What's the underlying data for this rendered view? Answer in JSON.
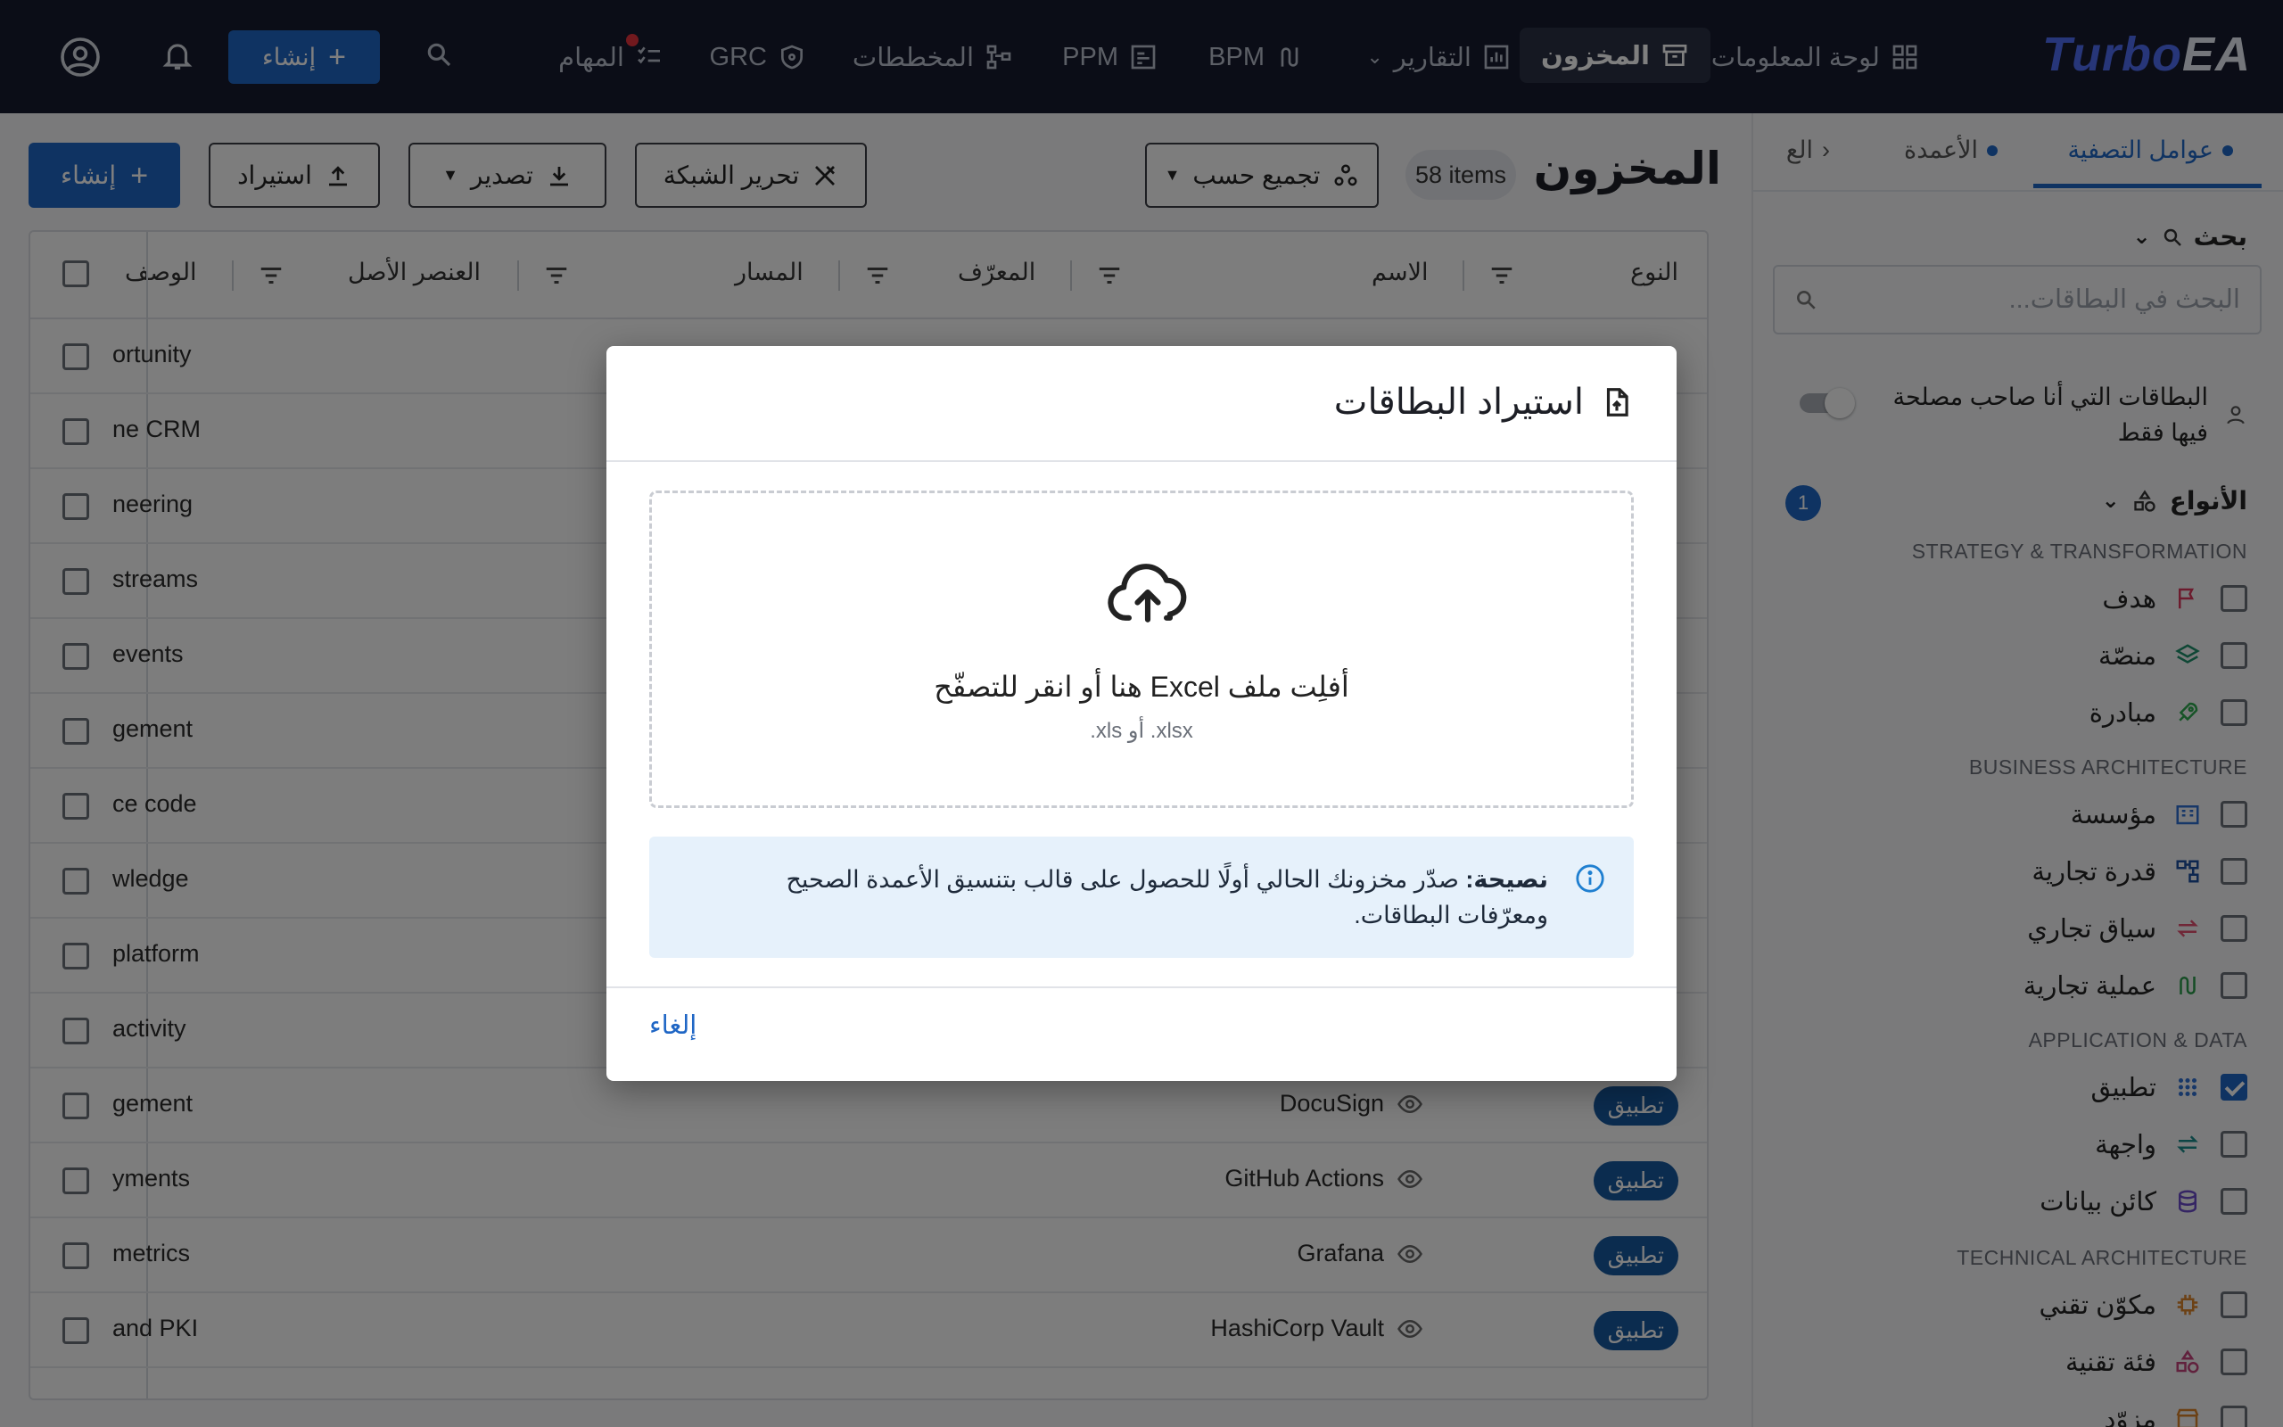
{
  "nav": {
    "logo_turbo": "Turbo",
    "logo_ea": "EA",
    "dashboard": "لوحة المعلومات",
    "inventory": "المخزون",
    "reports": "التقارير",
    "bpm": "BPM",
    "ppm": "PPM",
    "diagrams": "المخططات",
    "grc": "GRC",
    "tasks": "المهام",
    "create": "إنشاء"
  },
  "sidebar": {
    "tabs": {
      "filters": "عوامل التصفية",
      "columns": "الأعمدة",
      "more": "الع"
    },
    "search_title": "بحث",
    "search_placeholder": "البحث في البطاقات...",
    "stakeholder_line1": "البطاقات التي أنا صاحب مصلحة",
    "stakeholder_line2": "فيها فقط",
    "types_title": "الأنواع",
    "types_count": "1",
    "groups": {
      "strategy": "STRATEGY & TRANSFORMATION",
      "business": "BUSINESS ARCHITECTURE",
      "app": "APPLICATION & DATA",
      "tech": "TECHNICAL ARCHITECTURE"
    },
    "types": {
      "objective": "هدف",
      "platform": "منصّة",
      "initiative": "مبادرة",
      "organization": "مؤسسة",
      "capability": "قدرة تجارية",
      "context": "سياق تجاري",
      "process": "عملية تجارية",
      "application": "تطبيق",
      "interface": "واجهة",
      "data_object": "كائن بيانات",
      "it_component": "مكوّن تقني",
      "tech_category": "فئة تقنية",
      "provider": "مزوّد"
    }
  },
  "main": {
    "title": "المخزون",
    "count": "58 items",
    "group_by": "تجميع حسب",
    "edit_grid": "تحرير الشبكة",
    "export": "تصدير",
    "import": "استيراد",
    "create": "إنشاء",
    "columns": {
      "type": "النوع",
      "name": "الاسم",
      "id": "المعرّف",
      "path": "المسار",
      "parent": "العنصر الأصل",
      "description": "الوصف"
    },
    "rows": [
      {
        "desc": "ortunity",
        "name": "",
        "type": ""
      },
      {
        "desc": "ne CRM",
        "name": "",
        "type": ""
      },
      {
        "desc": "neering",
        "name": "",
        "type": ""
      },
      {
        "desc": "streams",
        "name": "",
        "type": ""
      },
      {
        "desc": " events",
        "name": "",
        "type": ""
      },
      {
        "desc": "gement",
        "name": "",
        "type": ""
      },
      {
        "desc": "ce code",
        "name": "",
        "type": ""
      },
      {
        "desc": "wledge",
        "name": "",
        "type": ""
      },
      {
        "desc": "platform",
        "name": "",
        "type": ""
      },
      {
        "desc": " activity",
        "name": "",
        "type": ""
      },
      {
        "desc": "gement",
        "name": "DocuSign",
        "type": "تطبيق"
      },
      {
        "desc": "yments",
        "name": "GitHub Actions",
        "type": "تطبيق"
      },
      {
        "desc": "metrics",
        "name": "Grafana",
        "type": "تطبيق"
      },
      {
        "desc": "and PKI",
        "name": "HashiCorp Vault",
        "type": "تطبيق"
      }
    ]
  },
  "dialog": {
    "title": "استيراد البطاقات",
    "drop_main": "أفلِت ملف Excel هنا أو انقر للتصفّح",
    "drop_sub": "xlsx. أو xls.",
    "tip_label": "نصيحة:",
    "tip_text": " صدّر مخزونك الحالي أولًا للحصول على قالب بتنسيق الأعمدة الصحيح ومعرّفات البطاقات.",
    "cancel": "إلغاء"
  },
  "colors": {
    "topbar": "#161b2e",
    "primary": "#1f66c5",
    "chip": "#17589f",
    "tip_bg": "#e6f1fb"
  }
}
